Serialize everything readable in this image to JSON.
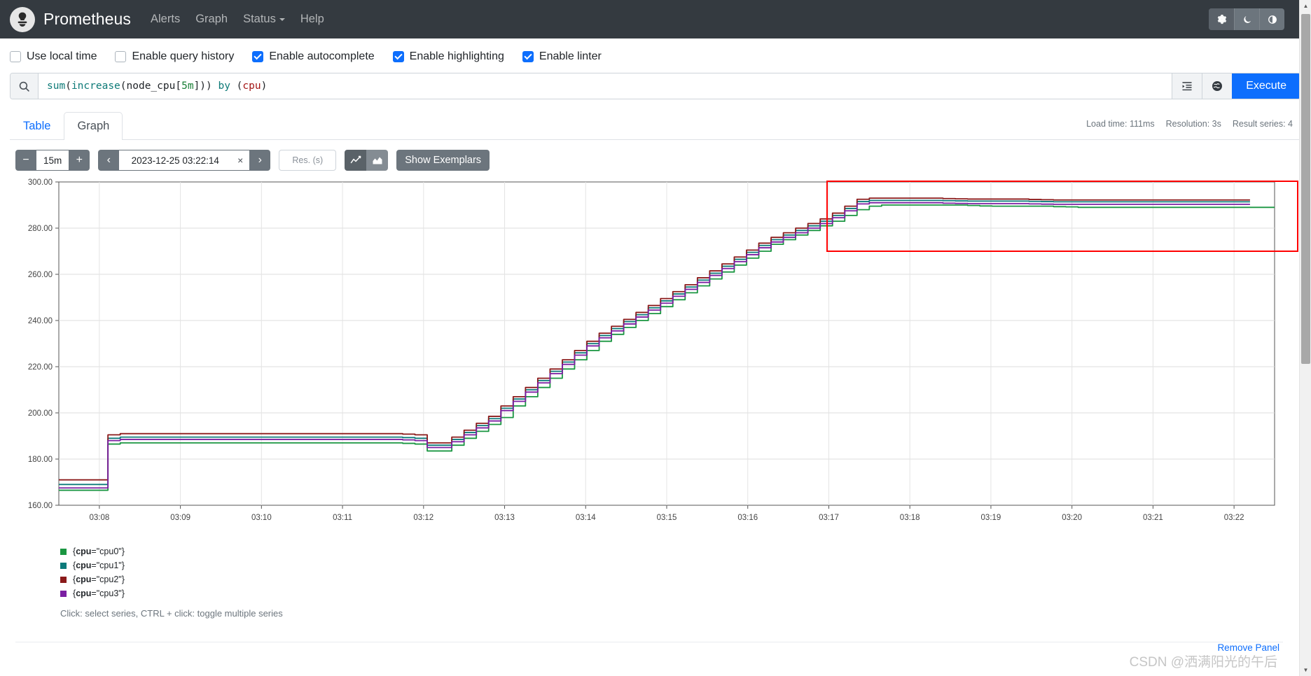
{
  "navbar": {
    "brand": "Prometheus",
    "logo_icon": "prometheus-logo-icon",
    "links": [
      {
        "label": "Alerts",
        "name": "alerts"
      },
      {
        "label": "Graph",
        "name": "graph"
      },
      {
        "label": "Status",
        "name": "status",
        "has_caret": true
      },
      {
        "label": "Help",
        "name": "help"
      }
    ],
    "theme_buttons": [
      {
        "icon": "gear-icon",
        "glyph": "⚙",
        "active": true
      },
      {
        "icon": "moon-icon",
        "glyph": "☾",
        "active": false
      },
      {
        "icon": "half-circle-contrast-icon",
        "glyph": "◐",
        "active": false
      }
    ]
  },
  "options": [
    {
      "label": "Use local time",
      "checked": false,
      "name": "use-local-time"
    },
    {
      "label": "Enable query history",
      "checked": false,
      "name": "enable-query-history"
    },
    {
      "label": "Enable autocomplete",
      "checked": true,
      "name": "enable-autocomplete"
    },
    {
      "label": "Enable highlighting",
      "checked": true,
      "name": "enable-highlighting"
    },
    {
      "label": "Enable linter",
      "checked": true,
      "name": "enable-linter"
    }
  ],
  "query": {
    "text": "sum(increase(node_cpu[5m])) by (cpu)",
    "tokens": [
      {
        "t": "sum",
        "c": "fn"
      },
      {
        "t": "(",
        "c": "paren"
      },
      {
        "t": "increase",
        "c": "fn"
      },
      {
        "t": "(",
        "c": "paren"
      },
      {
        "t": "node_cpu",
        "c": "metric"
      },
      {
        "t": "[",
        "c": "paren"
      },
      {
        "t": "5m",
        "c": "dur"
      },
      {
        "t": "])) ",
        "c": "paren"
      },
      {
        "t": "by",
        "c": "kw"
      },
      {
        "t": " (",
        "c": "paren"
      },
      {
        "t": "cpu",
        "c": "label"
      },
      {
        "t": ")",
        "c": "paren"
      }
    ],
    "search_icon": "search-icon",
    "format_icon": "format-query-icon",
    "metric_explorer_icon": "metrics-explorer-globe-icon",
    "execute_label": "Execute"
  },
  "tabs": [
    {
      "label": "Table",
      "active": false,
      "name": "tab-table"
    },
    {
      "label": "Graph",
      "active": true,
      "name": "tab-graph"
    }
  ],
  "meta": {
    "load_time": "Load time: 111ms",
    "resolution": "Resolution: 3s",
    "result_series": "Result series: 4"
  },
  "controls": {
    "range_decrease": "−",
    "range_value": "15m",
    "range_increase": "+",
    "time_prev": "‹",
    "time_value": "2023-12-25 03:22:14",
    "time_clear": "×",
    "time_next": "›",
    "resolution_placeholder": "Res. (s)",
    "line_chart_icon": "line-chart-icon",
    "stacked_chart_icon": "stacked-chart-icon",
    "show_exemplars": "Show Exemplars"
  },
  "chart_data": {
    "type": "line",
    "title": "",
    "xlabel": "",
    "ylabel": "",
    "ylim": [
      160,
      300
    ],
    "yticks": [
      "160.00",
      "180.00",
      "200.00",
      "220.00",
      "240.00",
      "260.00",
      "280.00",
      "300.00"
    ],
    "ytick_values": [
      160,
      180,
      200,
      220,
      240,
      260,
      280,
      300
    ],
    "xticks": [
      "03:08",
      "03:09",
      "03:10",
      "03:11",
      "03:12",
      "03:13",
      "03:14",
      "03:15",
      "03:16",
      "03:17",
      "03:18",
      "03:19",
      "03:20",
      "03:21",
      "03:22"
    ],
    "grid": true,
    "legend_position": "bottom-left",
    "x": [
      0,
      1,
      2,
      3,
      4,
      5,
      6,
      7,
      8,
      9,
      10,
      11,
      12,
      13,
      14,
      15,
      16,
      17,
      18,
      19,
      20,
      21,
      22,
      23,
      24,
      25,
      26,
      27,
      28,
      29,
      30,
      31,
      32,
      33,
      34,
      35,
      36,
      37,
      38,
      39,
      40,
      41,
      42,
      43,
      44,
      45,
      46,
      47,
      48,
      49,
      50,
      51,
      52,
      53,
      54,
      55,
      56,
      57,
      58,
      59,
      60,
      61,
      62,
      63,
      64,
      65,
      66,
      67,
      68,
      69,
      70,
      71,
      72,
      73,
      74,
      75,
      76,
      77,
      78,
      79,
      80,
      81,
      82,
      83,
      84,
      85,
      86,
      87,
      88,
      89,
      90,
      91,
      92,
      93,
      94,
      95,
      96,
      97,
      98,
      99,
      100
    ],
    "series": [
      {
        "name": "{cpu=\"cpu0\"}",
        "color": "#1a9641",
        "values": [
          166.5,
          166.5,
          166.5,
          166.5,
          186.5,
          187,
          187,
          187,
          187,
          187,
          187,
          187,
          187,
          187,
          187,
          187,
          187,
          187,
          187,
          187,
          187,
          187,
          187,
          187,
          187,
          187,
          187,
          187,
          186.8,
          186.5,
          183.5,
          183.5,
          186,
          189,
          192,
          195,
          198,
          203,
          207,
          211,
          215,
          219,
          223,
          227,
          231,
          234,
          237,
          240,
          243,
          246,
          249,
          252,
          255,
          258,
          261,
          264,
          267,
          270,
          273,
          275,
          277,
          279,
          281,
          283,
          285.5,
          288,
          289.5,
          290,
          290,
          290,
          290,
          290,
          290,
          290,
          289.8,
          289.6,
          289.5,
          289.5,
          289.5,
          289.5,
          289.5,
          289.3,
          289.2,
          289,
          289,
          289,
          289,
          289,
          289,
          289,
          289,
          289,
          289,
          289,
          289,
          289,
          289,
          289,
          289,
          289
        ]
      },
      {
        "name": "{cpu=\"cpu1\"}",
        "color": "#0c7a7a",
        "values": [
          169,
          169,
          169,
          169,
          189,
          189.5,
          189.5,
          189.5,
          189.5,
          189.5,
          189.5,
          189.5,
          189.5,
          189.5,
          189.5,
          189.5,
          189.5,
          189.5,
          189.5,
          189.5,
          189.5,
          189.5,
          189.5,
          189.5,
          189.5,
          189.5,
          189.5,
          189.5,
          189.3,
          189,
          186,
          186,
          188.5,
          191.5,
          194.5,
          197.5,
          202,
          206,
          210,
          214,
          218,
          222,
          226,
          230,
          233.5,
          236.5,
          239.5,
          242.5,
          245.5,
          248.5,
          251.5,
          254.5,
          257.5,
          260.5,
          263.5,
          266.5,
          269.5,
          272.5,
          275,
          277,
          279,
          281,
          283,
          285.5,
          288.5,
          291.5,
          292,
          292,
          292,
          292,
          292,
          292,
          291.9,
          291.8,
          291.7,
          291.7,
          291.7,
          291.7,
          291.7,
          291.6,
          291.5,
          291.4,
          291.4,
          291.4,
          291.4,
          291.4,
          291.4,
          291.4,
          291.4,
          291.4,
          291.4,
          291.4,
          291.4,
          291.4,
          291.4,
          291.4,
          291.4,
          291.4
        ]
      },
      {
        "name": "{cpu=\"cpu2\"}",
        "color": "#8b1a1a",
        "values": [
          171,
          171,
          171,
          171,
          190.5,
          191,
          191,
          191,
          191,
          191,
          191,
          191,
          191,
          191,
          191,
          191,
          191,
          191,
          191,
          191,
          191,
          191,
          191,
          191,
          191,
          191,
          191,
          191,
          190.8,
          190.5,
          187,
          187,
          189.5,
          192.5,
          195.5,
          198.5,
          203,
          207,
          211,
          215,
          219,
          223,
          227,
          231,
          234.5,
          237.5,
          240.5,
          243.5,
          246.5,
          249.5,
          252.5,
          255.5,
          258.5,
          261.5,
          264.5,
          267.5,
          270.5,
          273.5,
          276,
          278,
          280,
          282,
          284,
          286.5,
          289.5,
          292.5,
          293,
          293,
          293,
          293,
          293,
          293,
          292.8,
          292.7,
          292.6,
          292.6,
          292.6,
          292.6,
          292.6,
          292.4,
          292.3,
          292.2,
          292.2,
          292.2,
          292.2,
          292.2,
          292.2,
          292.2,
          292.2,
          292.2,
          292.2,
          292.2,
          292.2,
          292.2,
          292.2,
          292.2,
          292.2,
          292.2
        ]
      },
      {
        "name": "{cpu=\"cpu3\"}",
        "color": "#7b1fa2",
        "values": [
          167.5,
          167.5,
          167.5,
          167.5,
          188,
          188.5,
          188.5,
          188.5,
          188.5,
          188.5,
          188.5,
          188.5,
          188.5,
          188.5,
          188.5,
          188.5,
          188.5,
          188.5,
          188.5,
          188.5,
          188.5,
          188.5,
          188.5,
          188.5,
          188.5,
          188.5,
          188.5,
          188.5,
          188.3,
          188,
          185,
          185,
          187.5,
          190.5,
          193.5,
          196.5,
          201,
          205,
          209,
          213,
          217,
          221,
          225,
          229,
          232.5,
          235.5,
          238.5,
          241.5,
          244.5,
          247.5,
          250.5,
          253.5,
          256.5,
          259.5,
          262.5,
          265.5,
          268.5,
          271.5,
          274,
          276,
          278,
          280,
          282,
          284.5,
          287.5,
          290.5,
          291,
          291,
          291,
          291,
          291,
          291,
          290.8,
          290.7,
          290.6,
          290.6,
          290.6,
          290.6,
          290.6,
          290.5,
          290.4,
          290.3,
          290.3,
          290.3,
          290.3,
          290.3,
          290.3,
          290.3,
          290.3,
          290.3,
          290.3,
          290.3,
          290.3,
          290.3,
          290.3,
          290.3,
          290.3,
          290.3
        ]
      }
    ],
    "annotation": {
      "type": "rect-highlight",
      "color": "#ff0000",
      "label": ""
    }
  },
  "legend": {
    "items": [
      {
        "label": "{cpu=\"cpu0\"}",
        "key": "cpu",
        "value": "\"cpu0\"",
        "color": "#1a9641"
      },
      {
        "label": "{cpu=\"cpu1\"}",
        "key": "cpu",
        "value": "\"cpu1\"",
        "color": "#0c7a7a"
      },
      {
        "label": "{cpu=\"cpu2\"}",
        "key": "cpu",
        "value": "\"cpu2\"",
        "color": "#8b1a1a"
      },
      {
        "label": "{cpu=\"cpu3\"}",
        "key": "cpu",
        "value": "\"cpu3\"",
        "color": "#7b1fa2"
      }
    ],
    "hint": "Click: select series, CTRL + click: toggle multiple series"
  },
  "footer": {
    "remove_panel": "Remove Panel",
    "watermark": "CSDN @洒满阳光的午后"
  },
  "colors": {
    "accent": "#0d6efd",
    "navbar_bg": "#343a40",
    "highlight": "#ff0000"
  }
}
